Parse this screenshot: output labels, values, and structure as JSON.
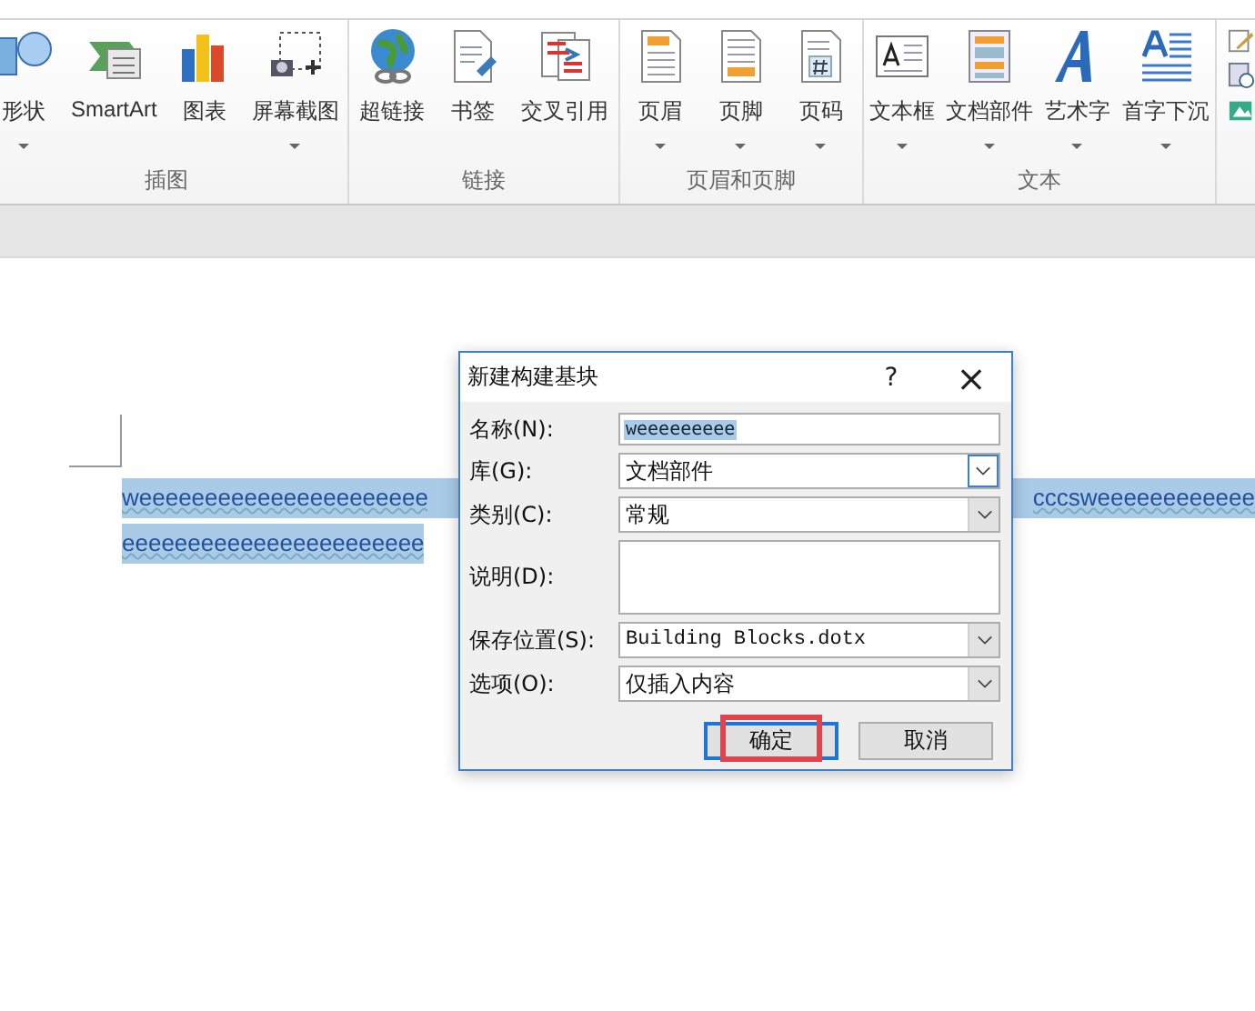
{
  "ribbon": {
    "groups": [
      {
        "label": "插图",
        "buttons": [
          {
            "label": "形状",
            "dropdown": true
          },
          {
            "label": "SmartArt",
            "dropdown": false
          },
          {
            "label": "图表",
            "dropdown": false
          },
          {
            "label": "屏幕截图",
            "dropdown": true
          }
        ]
      },
      {
        "label": "链接",
        "buttons": [
          {
            "label": "超链接",
            "dropdown": false
          },
          {
            "label": "书签",
            "dropdown": false
          },
          {
            "label": "交叉引用",
            "dropdown": false
          }
        ]
      },
      {
        "label": "页眉和页脚",
        "buttons": [
          {
            "label": "页眉",
            "dropdown": true
          },
          {
            "label": "页脚",
            "dropdown": true
          },
          {
            "label": "页码",
            "dropdown": true
          }
        ]
      },
      {
        "label": "文本",
        "buttons": [
          {
            "label": "文本框",
            "dropdown": true
          },
          {
            "label": "文档部件",
            "dropdown": true
          },
          {
            "label": "艺术字",
            "dropdown": true
          },
          {
            "label": "首字下沉",
            "dropdown": true
          }
        ]
      }
    ]
  },
  "document": {
    "lines": [
      {
        "left": "weeeeeeeeeeeeeeeeeeeeee",
        "right": "cccsweeeeeeeeeeee",
        "selected": true
      },
      {
        "left": "eeeeeeeeeeeeeeeeeeeeeee",
        "selected": true
      }
    ]
  },
  "dialog": {
    "title": "新建构建基块",
    "help": "?",
    "close": "×",
    "fields": [
      {
        "kind": "text",
        "label": "名称(N):",
        "value": "weeeeeeeee",
        "value_selected": true
      },
      {
        "kind": "dropdown",
        "label": "库(G):",
        "value": "文档部件",
        "active": true
      },
      {
        "kind": "dropdown",
        "label": "类别(C):",
        "value": "常规",
        "active": false
      },
      {
        "kind": "textarea",
        "label": "说明(D):"
      },
      {
        "kind": "dropdown",
        "label": "保存位置(S):",
        "value": "Building Blocks.dotx",
        "active": false,
        "mono": true
      },
      {
        "kind": "dropdown",
        "label": "选项(O):",
        "value": "仅插入内容",
        "active": false
      }
    ],
    "buttons": [
      {
        "label": "确定",
        "default": true,
        "highlighted": true
      },
      {
        "label": "取消",
        "default": false,
        "highlighted": false
      }
    ]
  }
}
